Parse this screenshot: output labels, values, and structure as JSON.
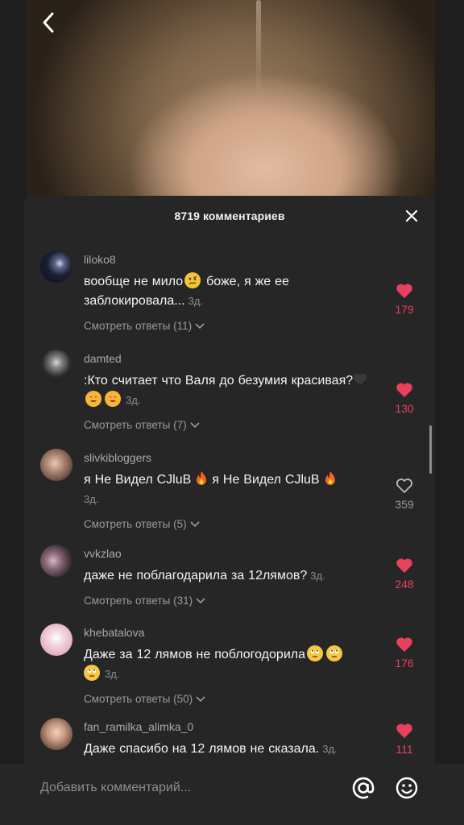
{
  "header": {
    "title": "8719 комментариев",
    "back_icon": "chevron-left-icon",
    "close_icon": "close-icon"
  },
  "comments": [
    {
      "username": "liloko8",
      "text_parts": [
        "вообще не мило",
        "боже, я же ее заблокировала..."
      ],
      "timestamp": "3д.",
      "replies_label": "Смотреть ответы (11)",
      "likes": "179",
      "liked": true
    },
    {
      "username": "damted",
      "text_parts": [
        ":Кто считает что Валя до безумия красивая?"
      ],
      "timestamp": "3д.",
      "replies_label": "Смотреть ответы (7)",
      "likes": "130",
      "liked": true
    },
    {
      "username": "slivkibloggers",
      "text_parts": [
        "я Не Bидел CJluB",
        "я Не Bидел CJluB"
      ],
      "timestamp": "3д.",
      "replies_label": "Смотреть ответы (5)",
      "likes": "359",
      "liked": false
    },
    {
      "username": "vvkzlao",
      "text_parts": [
        "даже не поблагодарила за 12лямов?"
      ],
      "timestamp": "3д.",
      "replies_label": "Смотреть ответы (31)",
      "likes": "248",
      "liked": true
    },
    {
      "username": "khebatalova",
      "text_parts": [
        "Даже за 12 лямов не поблогодорила"
      ],
      "timestamp": "3д.",
      "replies_label": "Смотреть ответы (50)",
      "likes": "176",
      "liked": true
    },
    {
      "username": "fan_ramilka_alimka_0",
      "text_parts": [
        "Даже спасибо на 12 лямов не сказала."
      ],
      "timestamp": "3д.",
      "replies_label": "",
      "likes": "111",
      "liked": true
    }
  ],
  "input": {
    "placeholder": "Добавить комментарий...",
    "mention_icon": "at-sign-icon",
    "emoji_icon": "smiley-icon"
  },
  "colors": {
    "panel_bg": "#262626",
    "like_red": "#e8405f",
    "text_primary": "#f4f4f4",
    "text_secondary": "#a9a9a9"
  }
}
